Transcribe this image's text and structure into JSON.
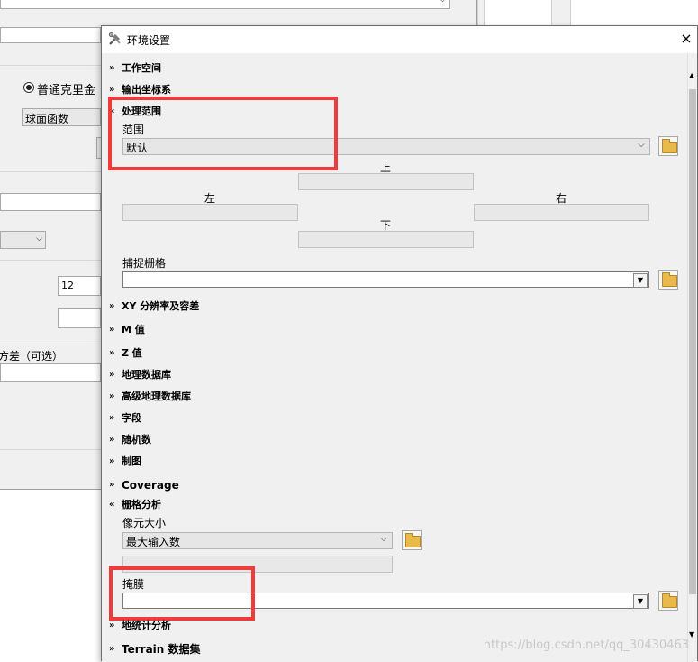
{
  "background": {
    "radio_label": "普通克里金",
    "method_value": "球面函数",
    "field_12": "12",
    "error_label": "方差（可选）"
  },
  "dialog": {
    "title": "环境设置",
    "close": "×",
    "sections_top": [
      {
        "label": "工作空间",
        "expanded": false
      },
      {
        "label": "输出坐标系",
        "expanded": false
      },
      {
        "label": "处理范围",
        "expanded": true
      }
    ],
    "extent": {
      "label": "范围",
      "value": "默认",
      "top": "上",
      "left": "左",
      "right": "右",
      "bottom": "下"
    },
    "snap": {
      "label": "捕捉栅格"
    },
    "sections_mid": [
      {
        "label": "XY 分辨率及容差"
      },
      {
        "label": "M 值"
      },
      {
        "label": "Z 值"
      },
      {
        "label": "地理数据库"
      },
      {
        "label": "高级地理数据库"
      },
      {
        "label": "字段"
      },
      {
        "label": "随机数"
      },
      {
        "label": "制图"
      },
      {
        "label": "Coverage"
      }
    ],
    "raster": {
      "label": "栅格分析",
      "cell_size_label": "像元大小",
      "cell_size_value": "最大输入数",
      "mask_label": "掩膜"
    },
    "sections_bottom": [
      {
        "label": "地统计分析"
      },
      {
        "label": "Terrain 数据集"
      }
    ]
  },
  "watermark": "https://blog.csdn.net/qq_30430463",
  "colors": {
    "highlight": "#ef3b3b",
    "folder": "#e9b94a"
  },
  "icons": [
    "tools-icon",
    "folder-icon",
    "chevron-down-icon",
    "chevron-up-icon"
  ]
}
